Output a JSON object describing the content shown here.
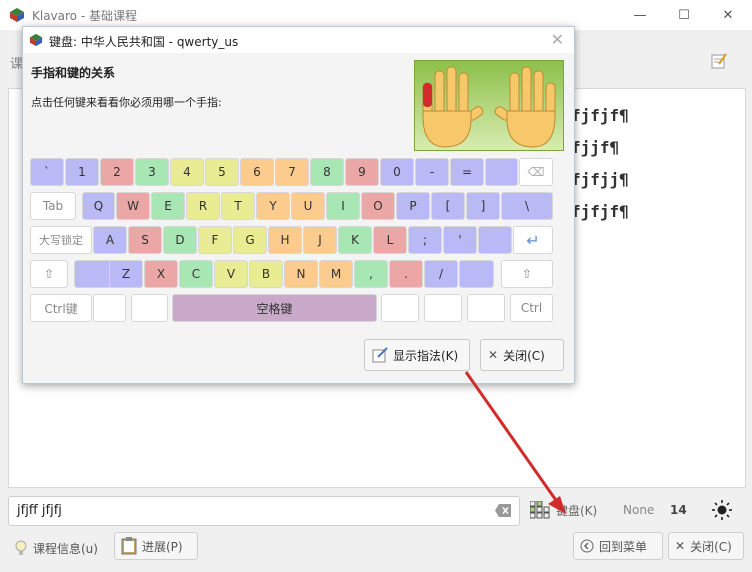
{
  "window": {
    "title": "Klavaro - 基础课程",
    "minimize_glyph": "—",
    "maximize_glyph": "☐",
    "close_glyph": "✕"
  },
  "lesson": {
    "label": "课",
    "lines": [
      "fjfjf¶",
      "fjjf¶",
      "fjfjj¶",
      "fjfjf¶"
    ]
  },
  "input": {
    "value": "jfjff jfjfj"
  },
  "keyboard_button": {
    "label": "键盘(K)"
  },
  "stats": {
    "mode": "None",
    "value": "14"
  },
  "bottom": {
    "lesson_info": "课程信息(u)",
    "progress": "进展(P)",
    "back_menu": "回到菜单",
    "close": "关闭(C)"
  },
  "dialog": {
    "title": "键盘: 中华人民共和国 - qwerty_us",
    "heading": "手指和键的关系",
    "hint": "点击任何键来看看你必须用哪一个手指:",
    "show_fingering": "显示指法(K)",
    "close": "关闭(C)"
  },
  "keys": {
    "row1": [
      "`",
      "1",
      "2",
      "3",
      "4",
      "5",
      "6",
      "7",
      "8",
      "9",
      "0",
      "-",
      "=",
      "⌫"
    ],
    "row2": [
      "Tab",
      "Q",
      "W",
      "E",
      "R",
      "T",
      "Y",
      "U",
      "I",
      "O",
      "P",
      "[",
      "]",
      "\\"
    ],
    "row3": [
      "大写锁定",
      "A",
      "S",
      "D",
      "F",
      "G",
      "H",
      "J",
      "K",
      "L",
      ";",
      "'",
      "",
      "↵"
    ],
    "row4": [
      "⇧",
      "",
      "Z",
      "X",
      "C",
      "V",
      "B",
      "N",
      "M",
      ",",
      ".",
      "/",
      "",
      "⇧"
    ],
    "row5": [
      "Ctrl键",
      "",
      "",
      "空格键",
      "",
      "",
      "",
      "Ctrl"
    ]
  },
  "colors": {
    "pinky": "#b9b9f6",
    "ring": "#eba6a6",
    "middle": "#a8e6b4",
    "index_left": "#e9ec93",
    "index_right": "#fbcc8e",
    "space": "#c9a9c9",
    "neutral": "#ffffff",
    "arrow": "#d22b2b"
  }
}
